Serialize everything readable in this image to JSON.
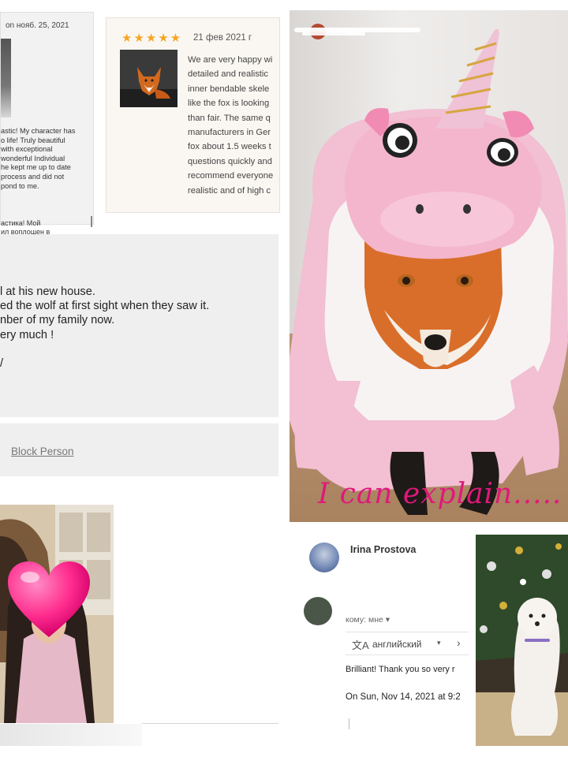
{
  "review_left": {
    "date": "on нояб. 25, 2021",
    "lines": [
      "astic! My character has",
      "o life! Truly beautiful",
      "with exceptional",
      "wonderful Individual",
      "he kept me up to date",
      " process and did not",
      "pond to me."
    ],
    "ru_lines": [
      "астика! Мой",
      "ил воплощен в"
    ]
  },
  "review_right": {
    "stars": "★★★★★",
    "date": "21 фев 2021 г",
    "lines": [
      "We are very happy wi",
      "detailed and realistic",
      "inner bendable skele",
      "like the fox is looking",
      "than fair. The same q",
      "manufacturers in Ger",
      "fox about 1.5 weeks t",
      "questions quickly and",
      "recommend everyone",
      "realistic and of high c"
    ]
  },
  "email_text": {
    "lines": [
      "l at his new house.",
      "ed the wolf at first sight when they saw it.",
      "nber of my family now.",
      "ery much !",
      "",
      "/"
    ],
    "block_link": "Block Person"
  },
  "fox_photo": {
    "caption": "I can explain....."
  },
  "gmail": {
    "sender1": "Irina Prostova",
    "sender2": "",
    "to_label": "кому: мне ▾",
    "translate_icon": "文A",
    "language": "английский",
    "caret": "▾",
    "next": "›",
    "message": "Brilliant! Thank you so very r",
    "quoted_date": "On Sun, Nov 14, 2021 at 9:2"
  },
  "colors": {
    "star": "#f5a623",
    "caption": "#e0187a",
    "heart": "#ff2d8e"
  }
}
